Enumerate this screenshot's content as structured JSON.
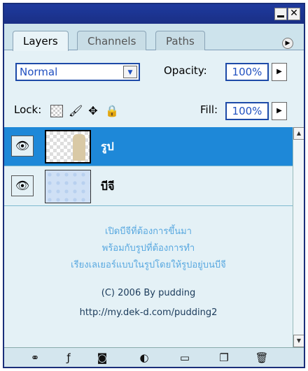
{
  "tabs": [
    {
      "label": "Layers",
      "active": true
    },
    {
      "label": "Channels",
      "active": false
    },
    {
      "label": "Paths",
      "active": false
    }
  ],
  "blend_mode": "Normal",
  "opacity": {
    "label": "Opacity:",
    "value": "100%"
  },
  "lock": {
    "label": "Lock:"
  },
  "fill": {
    "label": "Fill:",
    "value": "100%"
  },
  "layers": [
    {
      "name": "รูป",
      "selected": true,
      "visible": true
    },
    {
      "name": "บีจี",
      "selected": false,
      "visible": true
    }
  ],
  "watermark": {
    "line1": "เปิดบีจีที่ต้องการขึ้นมา",
    "line2": "พร้อมกับรูปที่ต้องการทำ",
    "line3": "เรียงเลเยอร์แบบในรูปโดยให้รูปอยู่บนบีจี",
    "credit": "(C) 2006 By pudding",
    "url": "http://my.dek-d.com/pudding2"
  },
  "colors": {
    "selection": "#1e88d8",
    "title_bar": "#1e3a9e",
    "panel": "#e4f1f6"
  },
  "icons": [
    "link-icon",
    "layer-style-icon",
    "layer-mask-icon",
    "adjustment-layer-icon",
    "new-group-icon",
    "new-layer-icon",
    "trash-icon"
  ]
}
